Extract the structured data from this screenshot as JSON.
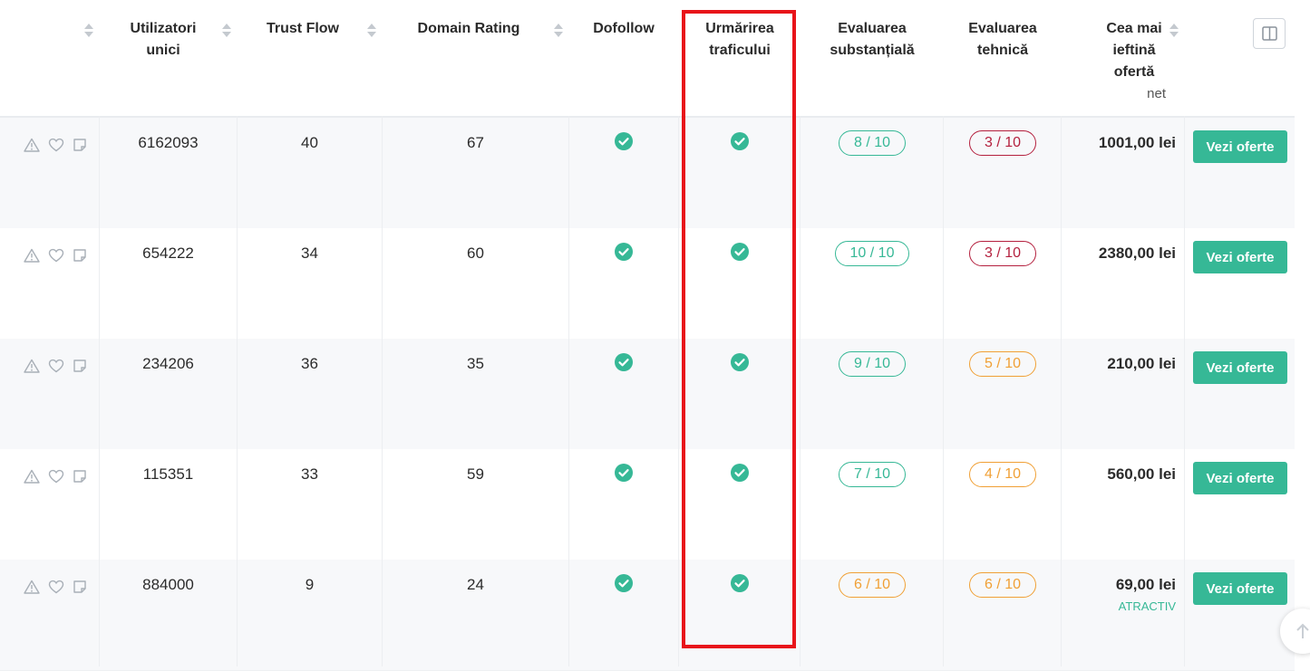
{
  "headers": {
    "unique_users": "Utilizatori unici",
    "trust_flow": "Trust Flow",
    "domain_rating": "Domain Rating",
    "dofollow": "Dofollow",
    "traffic_tracking": "Urmărirea traficului",
    "substantial_eval": "Evaluarea substanțială",
    "technical_eval": "Evaluarea tehnică",
    "cheapest_offer": "Cea mai ieftină ofertă",
    "cheapest_offer_sub": "net"
  },
  "rows": [
    {
      "users": "6162093",
      "trust_flow": "40",
      "domain_rating": "67",
      "substantial": "8 / 10",
      "substantial_color": "green",
      "technical": "3 / 10",
      "technical_color": "red",
      "price": "1001,00 lei",
      "tag": "",
      "button": "Vezi oferte"
    },
    {
      "users": "654222",
      "trust_flow": "34",
      "domain_rating": "60",
      "substantial": "10 / 10",
      "substantial_color": "green",
      "technical": "3 / 10",
      "technical_color": "red",
      "price": "2380,00 lei",
      "tag": "",
      "button": "Vezi oferte"
    },
    {
      "users": "234206",
      "trust_flow": "36",
      "domain_rating": "35",
      "substantial": "9 / 10",
      "substantial_color": "green",
      "technical": "5 / 10",
      "technical_color": "orange",
      "price": "210,00 lei",
      "tag": "",
      "button": "Vezi oferte"
    },
    {
      "users": "115351",
      "trust_flow": "33",
      "domain_rating": "59",
      "substantial": "7 / 10",
      "substantial_color": "green",
      "technical": "4 / 10",
      "technical_color": "orange",
      "price": "560,00 lei",
      "tag": "",
      "button": "Vezi oferte"
    },
    {
      "users": "884000",
      "trust_flow": "9",
      "domain_rating": "24",
      "substantial": "6 / 10",
      "substantial_color": "orange",
      "technical": "6 / 10",
      "technical_color": "orange",
      "price": "69,00 lei",
      "tag": "ATRACTIV",
      "button": "Vezi oferte"
    }
  ],
  "colors": {
    "accent": "#36b896",
    "red": "#b4203e",
    "orange": "#f0a035",
    "highlight": "#e8141a"
  }
}
